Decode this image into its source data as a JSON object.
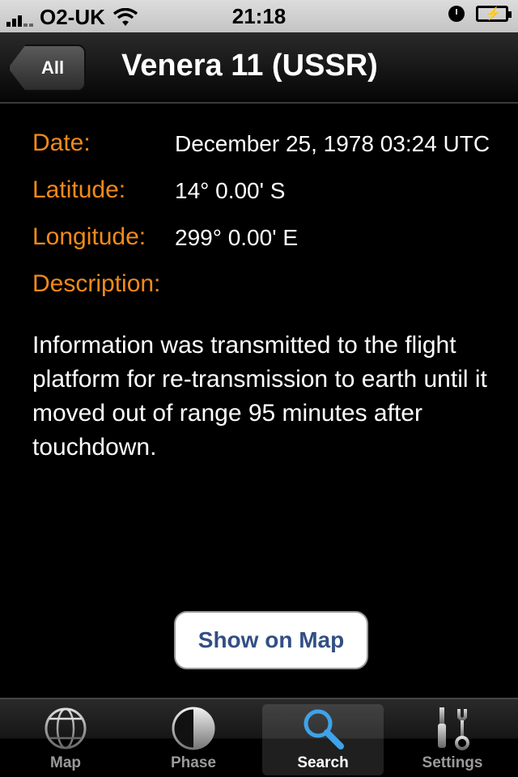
{
  "status_bar": {
    "carrier": "O2-UK",
    "time": "21:18"
  },
  "nav": {
    "back_label": "All",
    "title": "Venera 11 (USSR)"
  },
  "details": {
    "date_label": "Date:",
    "date_value": "December 25, 1978 03:24 UTC",
    "latitude_label": "Latitude:",
    "latitude_value": "14° 0.00' S",
    "longitude_label": "Longitude:",
    "longitude_value": "299° 0.00' E",
    "description_label": "Description:",
    "description_text": "Information was transmitted to the flight platform for re-transmission to earth until it moved out of range 95 minutes after touchdown."
  },
  "actions": {
    "show_on_map_label": "Show on Map"
  },
  "tab_bar": {
    "tabs": [
      {
        "label": "Map",
        "icon": "globe-icon"
      },
      {
        "label": "Phase",
        "icon": "moon-phase-icon"
      },
      {
        "label": "Search",
        "icon": "magnifier-icon",
        "active": true
      },
      {
        "label": "Settings",
        "icon": "tools-icon"
      }
    ]
  },
  "colors": {
    "label_orange": "#f28a1a",
    "button_text_blue": "#324f85",
    "active_tab_blue": "#3fa2e8"
  }
}
